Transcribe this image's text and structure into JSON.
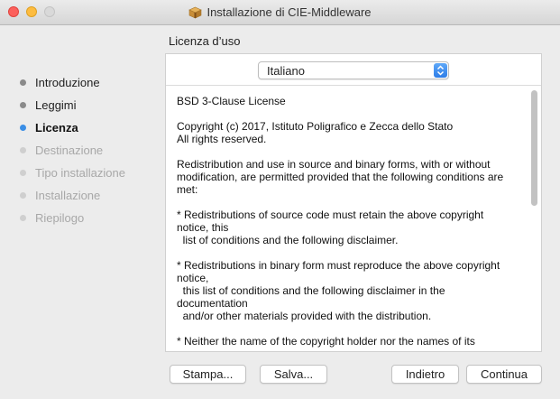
{
  "window": {
    "title": "Installazione di CIE-Middleware",
    "icon": "package-icon"
  },
  "sidebar": {
    "steps": [
      {
        "label": "Introduzione",
        "state": "done"
      },
      {
        "label": "Leggimi",
        "state": "done"
      },
      {
        "label": "Licenza",
        "state": "current"
      },
      {
        "label": "Destinazione",
        "state": "future"
      },
      {
        "label": "Tipo installazione",
        "state": "future"
      },
      {
        "label": "Installazione",
        "state": "future"
      },
      {
        "label": "Riepilogo",
        "state": "future"
      }
    ]
  },
  "main": {
    "section_title": "Licenza d’uso",
    "language_select": {
      "value": "Italiano"
    },
    "license_paragraphs": [
      "BSD 3-Clause License",
      "Copyright (c) 2017, Istituto Poligrafico e Zecca dello Stato\nAll rights reserved.",
      "Redistribution and use in source and binary forms, with or without\nmodification, are permitted provided that the following conditions are\nmet:",
      "* Redistributions of source code must retain the above copyright\nnotice, this\n  list of conditions and the following disclaimer.",
      "* Redistributions in binary form must reproduce the above copyright\nnotice,\n  this list of conditions and the following disclaimer in the\ndocumentation\n  and/or other materials provided with the distribution.",
      "* Neither the name of the copyright holder nor the names of its"
    ]
  },
  "buttons": {
    "print": "Stampa...",
    "save": "Salva...",
    "back": "Indietro",
    "continue": "Continua"
  },
  "colors": {
    "accent": "#3a8ee6",
    "close": "#fc605c",
    "minimize": "#fdbc40"
  }
}
